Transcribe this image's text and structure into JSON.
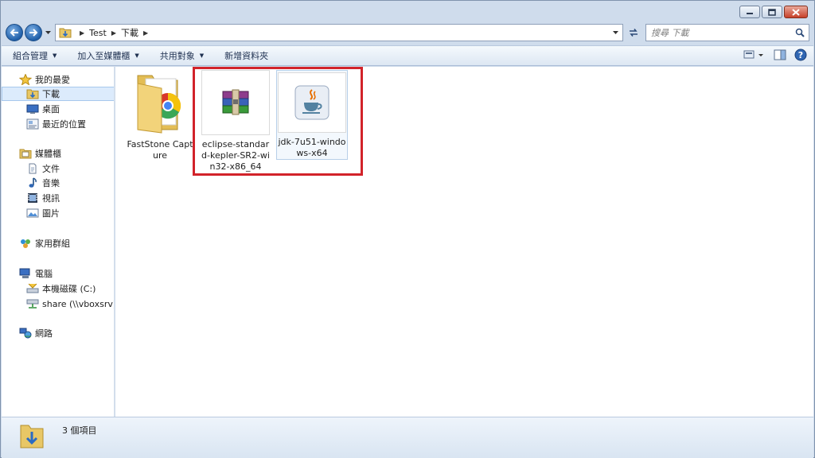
{
  "address": {
    "crumbs": [
      "Test",
      "下載"
    ]
  },
  "search": {
    "placeholder": "搜尋 下載"
  },
  "toolbar": {
    "organize": "組合管理",
    "include_in_library": "加入至媒體櫃",
    "share_with": "共用對象",
    "new_folder": "新增資料夾"
  },
  "sidebar": {
    "favorites": {
      "label": "我的最愛",
      "items": [
        {
          "label": "下載",
          "icon": "download-folder-icon",
          "selected": true
        },
        {
          "label": "桌面",
          "icon": "desktop-icon"
        },
        {
          "label": "最近的位置",
          "icon": "recent-places-icon"
        }
      ]
    },
    "libraries": {
      "label": "媒體櫃",
      "items": [
        {
          "label": "文件",
          "icon": "documents-icon"
        },
        {
          "label": "音樂",
          "icon": "music-icon"
        },
        {
          "label": "視訊",
          "icon": "video-icon"
        },
        {
          "label": "圖片",
          "icon": "pictures-icon"
        }
      ]
    },
    "homegroup": {
      "label": "家用群組"
    },
    "computer": {
      "label": "電腦",
      "items": [
        {
          "label": "本機磁碟 (C:)",
          "icon": "local-disk-icon"
        },
        {
          "label": "share (\\\\vboxsrv) (E",
          "icon": "network-drive-icon"
        }
      ]
    },
    "network": {
      "label": "網路"
    }
  },
  "files": [
    {
      "name": "FastStone Capture",
      "type": "folder",
      "icon": "folder-with-chrome-icon"
    },
    {
      "name": "eclipse-standard-kepler-SR2-win32-x86_64",
      "type": "rar-archive",
      "icon": "winrar-archive-icon"
    },
    {
      "name": "jdk-7u51-windows-x64",
      "type": "java-installer",
      "icon": "java-coffee-icon",
      "selected": true
    }
  ],
  "status": {
    "item_count": "3 個項目"
  },
  "colors": {
    "highlight": "#d2232a",
    "accent": "#1f5fa9"
  }
}
